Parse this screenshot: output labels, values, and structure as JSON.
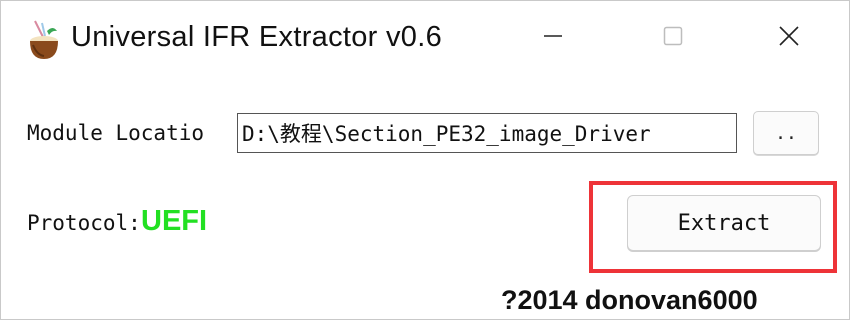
{
  "window": {
    "title": "Universal IFR Extractor v0.6",
    "app_icon": "coconut-drink-icon",
    "controls": {
      "minimize_icon": "minimize-icon",
      "maximize_icon": "maximize-icon",
      "close_icon": "close-icon"
    }
  },
  "module": {
    "label": "Module Locatio",
    "path_value": "D:\\教程\\Section_PE32_image_Driver",
    "browse_label": ".."
  },
  "protocol": {
    "label": "Protocol:",
    "value": "UEFI",
    "value_color": "#22e022"
  },
  "actions": {
    "extract_label": "Extract",
    "highlight_color": "#ee3338"
  },
  "footer": {
    "copyright": "?2014 donovan6000"
  }
}
